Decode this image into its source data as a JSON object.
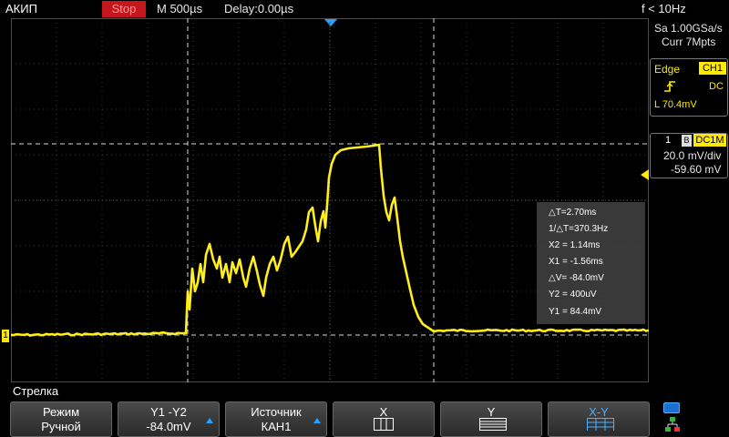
{
  "top": {
    "brand": "АКИП",
    "run_state": "Stop",
    "timebase": "M 500µs",
    "delay": "Delay:0.00µs",
    "freq": "f < 10Hz"
  },
  "acq": {
    "sample_rate": "Sa 1.00GSa/s",
    "memory": "Curr 7Mpts"
  },
  "trigger": {
    "type": "Edge",
    "source": "CH1",
    "coupling": "DC",
    "level": "L  70.4mV"
  },
  "channel": {
    "number": "1",
    "bw": "B",
    "coupling": "DC1M",
    "vdiv": "20.0 mV/div",
    "offset": "-59.60 mV",
    "marker": "1",
    "color": "#ffea00"
  },
  "readout": {
    "dt": "△T=2.70ms",
    "inv_dt": "1/△T=370.3Hz",
    "x2": "X2 = 1.14ms",
    "x1": "X1 = -1.56ms",
    "dv": "△V= -84.0mV",
    "y2": "Y2 = 400uV",
    "y1": "Y1 = 84.4mV"
  },
  "menu": {
    "title": "Стрелка",
    "keys": [
      {
        "l1": "Режим",
        "l2": "Ручной"
      },
      {
        "l1": "Y1 -Y2",
        "l2": "-84.0mV"
      },
      {
        "l1": "Источник",
        "l2": "КАН1"
      },
      {
        "l1": "X",
        "l2": ""
      },
      {
        "l1": "Y",
        "l2": ""
      },
      {
        "l1": "X-Y",
        "l2": ""
      }
    ]
  },
  "icons": {
    "run_stop": "stop-badge",
    "trigger_edge": "rising-edge-icon",
    "usb": "usb-icon",
    "network": "network-icon"
  }
}
